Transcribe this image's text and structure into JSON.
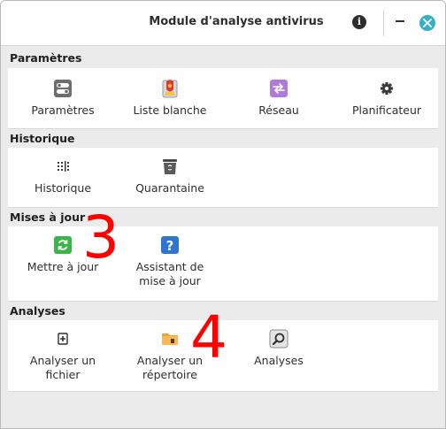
{
  "window": {
    "title": "Module d'analyse antivirus",
    "info_glyph": "i"
  },
  "sections": {
    "parametres": {
      "header": "Paramètres",
      "items": {
        "parametres": {
          "label": "Paramètres",
          "icon": "toggles-icon"
        },
        "liste_blanche": {
          "label": "Liste blanche",
          "icon": "whitelist-icon"
        },
        "reseau": {
          "label": "Réseau",
          "icon": "network-icon"
        },
        "planificateur": {
          "label": "Planificateur",
          "icon": "gear-icon"
        }
      }
    },
    "historique": {
      "header": "Historique",
      "items": {
        "historique": {
          "label": "Historique",
          "icon": "history-icon"
        },
        "quarantaine": {
          "label": "Quarantaine",
          "icon": "trash-icon"
        }
      }
    },
    "mises_a_jour": {
      "header": "Mises à jour",
      "items": {
        "mettre_a_jour": {
          "label": "Mettre à jour",
          "icon": "refresh-icon"
        },
        "assistant": {
          "label_line1": "Assistant de",
          "label_line2": "mise à jour",
          "icon": "help-icon"
        }
      }
    },
    "analyses": {
      "header": "Analyses",
      "items": {
        "analyser_fichier": {
          "label_line1": "Analyser un",
          "label_line2": "fichier",
          "icon": "add-file-icon"
        },
        "analyser_repertoire": {
          "label_line1": "Analyser un",
          "label_line2": "répertoire",
          "icon": "folder-icon"
        },
        "analyses": {
          "label": "Analyses",
          "icon": "magnifier-icon"
        }
      }
    }
  },
  "annotations": {
    "marker_3": "3",
    "marker_4": "4"
  },
  "colors": {
    "accent_close": "#35b0c8",
    "annotation": "#ff0000",
    "refresh_green": "#3bb54a",
    "help_blue": "#2f74d0",
    "network_purple": "#b07ad8",
    "folder_orange": "#f2a23a"
  }
}
